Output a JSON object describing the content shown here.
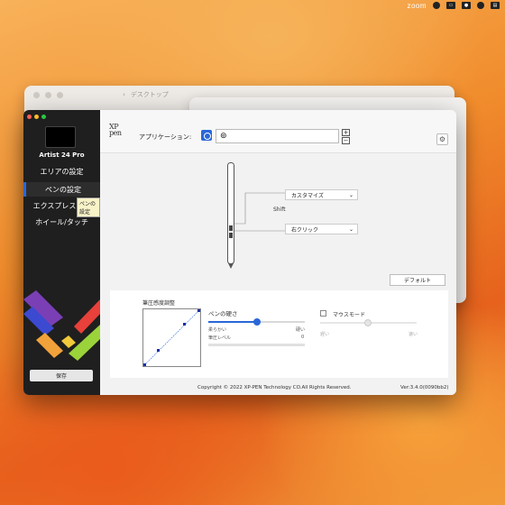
{
  "menubar": {
    "zoom_label": "zoom",
    "icons": [
      "control-center-icon",
      "screen-icon",
      "camera-icon",
      "user-icon",
      "display-icon"
    ]
  },
  "finder": {
    "title": "デスクトップ"
  },
  "sidebar": {
    "device_name": "Artist 24 Pro",
    "items": [
      {
        "label": "エリアの設定",
        "active": false
      },
      {
        "label": "ペンの設定",
        "active": true
      },
      {
        "label": "エクスプレスキー",
        "active": false
      },
      {
        "label": "ホイール/タッチ",
        "active": false
      }
    ],
    "tooltip": "ペンの設定",
    "save_label": "保存"
  },
  "header": {
    "logo_line1": "XP",
    "logo_line2": "pen",
    "app_label": "アプリケーション:",
    "add": "+",
    "remove": "−"
  },
  "pen_settings": {
    "upper_button": "カスタマイズ",
    "upper_sub": "Shift",
    "lower_button": "右クリック",
    "default_label": "デフォルト"
  },
  "pressure": {
    "title": "筆圧感度調整",
    "hardness_label": "ペンの硬さ",
    "soft_label": "柔らかい",
    "hard_label": "硬い",
    "hardness_value": 0.5,
    "level_label": "筆圧レベル",
    "level_value": "0"
  },
  "mouse_mode": {
    "label": "マウスモード",
    "slow": "遅い",
    "fast": "速い",
    "checked": false
  },
  "footer": {
    "copyright": "Copyright © 2022  XP-PEN Technology CO.All Rights Reserved.",
    "version": "Ver:3.4.0(0090bb2)"
  },
  "colors": {
    "accent": "#2a67d8",
    "sidebar_bg": "#1f1f1f",
    "wallpaper": "#f08c2c"
  }
}
